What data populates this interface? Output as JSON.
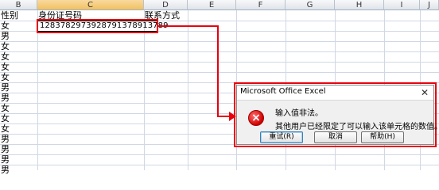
{
  "columns": [
    "B",
    "C",
    "D",
    "E",
    "F",
    "G",
    "H",
    "I",
    "J"
  ],
  "selected_column": "C",
  "header_row": {
    "b": "性别",
    "c": "身份证号码",
    "d": "联系方式"
  },
  "gender_values": [
    "女",
    "男",
    "女",
    "女",
    "女",
    "女",
    "男",
    "男",
    "女",
    "女",
    "女",
    "男",
    "男",
    "男",
    "男",
    "男"
  ],
  "active_cell_value": "128378297392879137891378​9",
  "dialog": {
    "title": "Microsoft Office Excel",
    "close": "✕",
    "message_title": "输入值非法。",
    "message_body": "其他用户已经限定了可以输入该单元格的数值。",
    "buttons": {
      "retry": "重试(R)",
      "cancel": "取消",
      "help": "帮助(H)"
    }
  },
  "colors": {
    "highlight": "#e8000d",
    "error_icon": "#d00000"
  }
}
